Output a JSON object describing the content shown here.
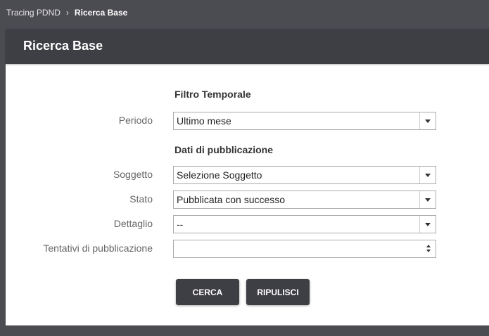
{
  "breadcrumb": {
    "parent": "Tracing PDND",
    "current": "Ricerca Base"
  },
  "panel": {
    "title": "Ricerca Base"
  },
  "form": {
    "section_time": "Filtro Temporale",
    "section_pub": "Dati di pubblicazione",
    "periodo": {
      "label": "Periodo",
      "value": "Ultimo mese"
    },
    "soggetto": {
      "label": "Soggetto",
      "value": "Selezione Soggetto"
    },
    "stato": {
      "label": "Stato",
      "value": "Pubblicata con successo"
    },
    "dettaglio": {
      "label": "Dettaglio",
      "value": "--"
    },
    "tentativi": {
      "label": "Tentativi di pubblicazione",
      "value": ""
    }
  },
  "buttons": {
    "search": "CERCA",
    "reset": "RIPULISCI"
  }
}
